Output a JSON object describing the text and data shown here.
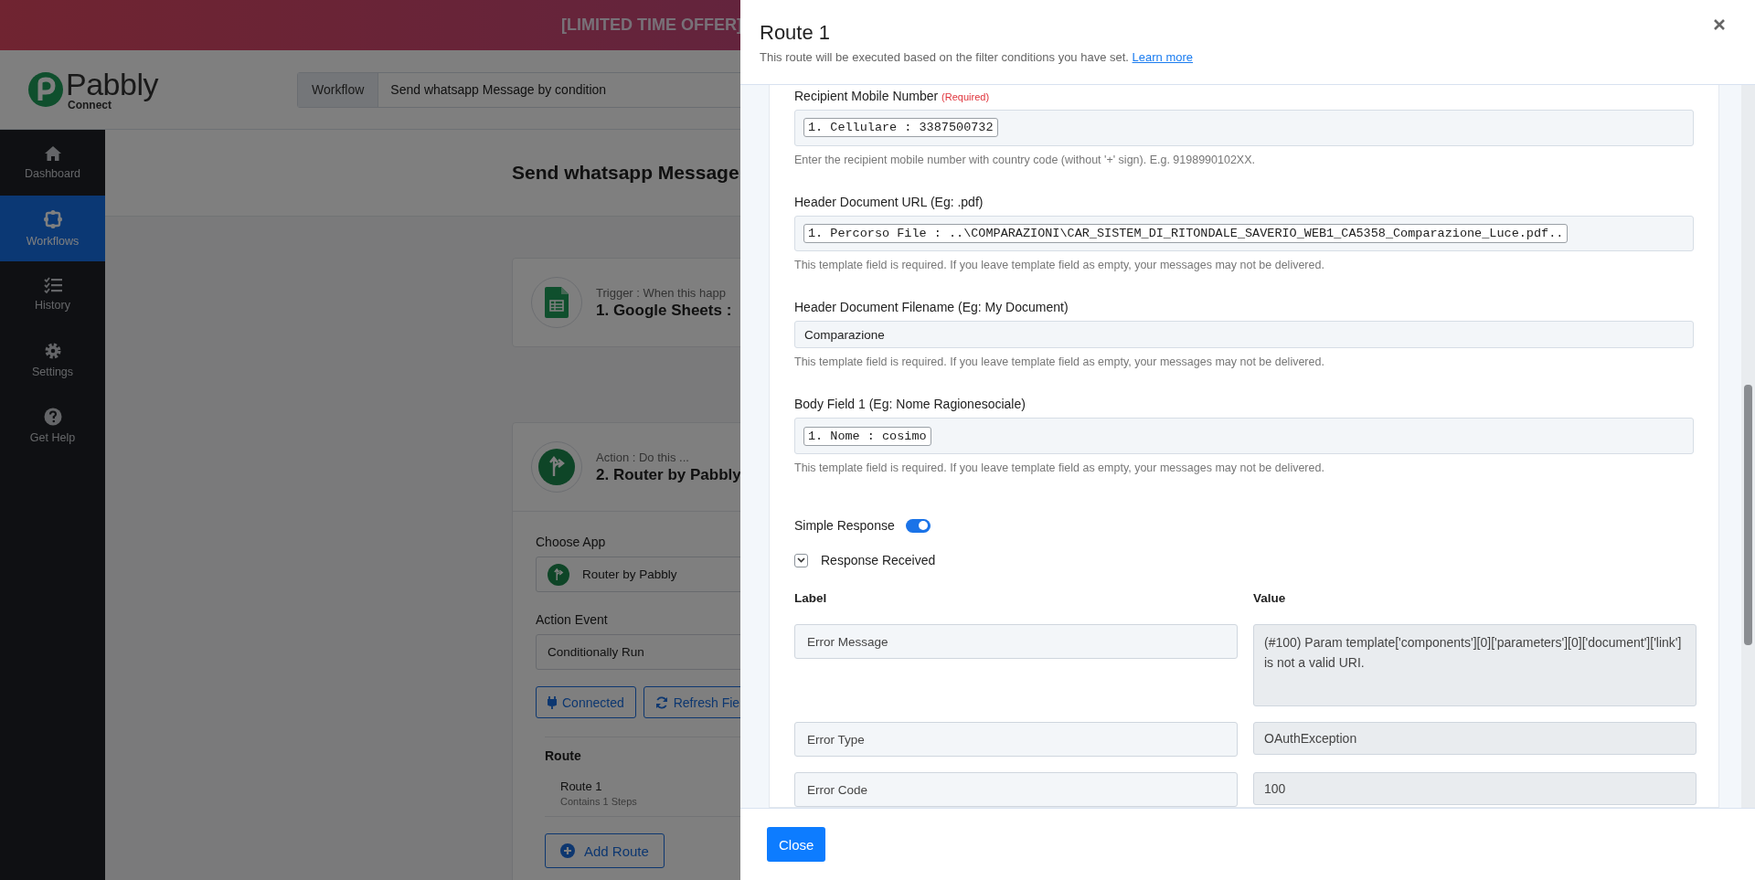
{
  "banner": {
    "text": "[LIMITED TIME OFFER]"
  },
  "header": {
    "logo_name": "Pabbly",
    "logo_sub": "Connect",
    "workflow_label": "Workflow",
    "workflow_name": "Send whatsapp Message by condition"
  },
  "sidebar": {
    "items": [
      {
        "label": "Dashboard",
        "selected": false
      },
      {
        "label": "Workflows",
        "selected": true
      },
      {
        "label": "History",
        "selected": false
      },
      {
        "label": "Settings",
        "selected": false
      },
      {
        "label": "Get Help",
        "selected": false
      }
    ]
  },
  "page_title": "Send whatsapp Message",
  "trigger": {
    "caption": "Trigger : When this happ",
    "title": "1. Google Sheets :"
  },
  "action": {
    "caption": "Action : Do this ...",
    "title": "2. Router by Pabbly",
    "choose_app_label": "Choose App",
    "app": "Router by Pabbly",
    "action_event_label": "Action Event",
    "action_event": "Conditionally Run",
    "buttons": [
      {
        "label": "Connected"
      },
      {
        "label": "Refresh Fie"
      }
    ],
    "route_heading": "Route",
    "routes": [
      {
        "name": "Route 1",
        "steps": "Contains 1 Steps"
      }
    ],
    "add_route": "Add Route"
  },
  "drawer": {
    "title": "Route 1",
    "subtitle": "This route will be executed based on the filter conditions you have set.",
    "link": "Learn more",
    "fields": [
      {
        "label": "Recipient Mobile Number",
        "required": "(Required)",
        "kind": "chips",
        "chips": [
          "1. Cellulare : 3387500732"
        ],
        "help": "Enter the recipient mobile number with country code (without '+' sign). E.g. 9198990102XX."
      },
      {
        "label": "Header Document URL (Eg: .pdf)",
        "kind": "chips",
        "chips": [
          "1. Percorso File : ..\\COMPARAZIONI\\CAR_SISTEM_DI_RITONDALE_SAVERIO_WEB1_CA5358_Comparazione_Luce.pdf.."
        ],
        "help": "This template field is required. If you leave template field as empty, your messages may not be delivered."
      },
      {
        "label": "Header Document Filename (Eg: My Document)",
        "kind": "text",
        "value": "Comparazione",
        "help": "This template field is required. If you leave template field as empty, your messages may not be delivered."
      },
      {
        "label": "Body Field 1 (Eg: Nome Ragionesociale)",
        "kind": "chips",
        "chips": [
          "1. Nome : cosimo"
        ],
        "help": "This template field is required. If you leave template field as empty, your messages may not be delivered."
      }
    ],
    "simple_response": {
      "label": "Simple Response",
      "on": true
    },
    "response": {
      "label": "Response Received",
      "expanded": true,
      "columns": [
        "Label",
        "Value"
      ],
      "rows": [
        {
          "label": "Error Message",
          "value": "(#100) Param template['components'][0]['parameters'][0]['document']['link'] is not a valid URI.",
          "kind": "multiline"
        },
        {
          "label": "Error Type",
          "value": "OAuthException",
          "kind": "single"
        },
        {
          "label": "Error Code",
          "value": "100",
          "kind": "single"
        }
      ]
    },
    "close_button": "Close"
  }
}
